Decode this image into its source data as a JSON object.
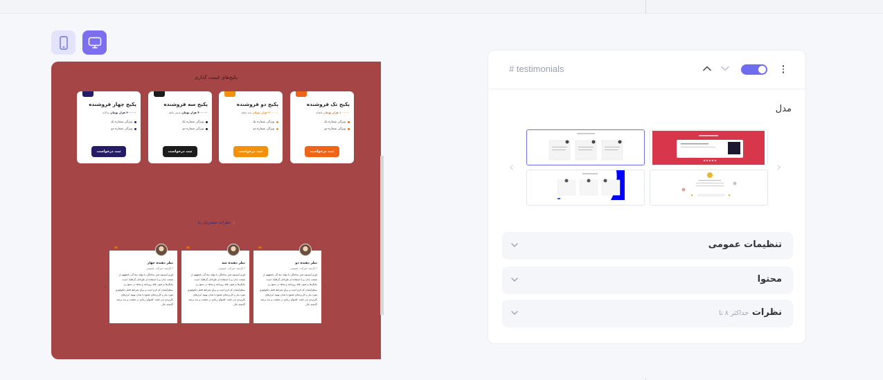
{
  "toolbar": {
    "mobile_icon": "mobile-phone-icon",
    "desktop_icon": "monitor-icon",
    "active_view": "desktop"
  },
  "preview": {
    "background": "#a64545",
    "pricing": {
      "title": "پکیج‌های قیمت گذاری",
      "plans": [
        {
          "name": "پکیج تک فروشنده",
          "price": "۱۰۰۰۰۰ هزار تومان",
          "period": "ماهانه",
          "features": [
            "ویژگی شماره یک",
            "ویژگی شماره دو"
          ],
          "button": "ثبت درخواست",
          "color": "#f0641a"
        },
        {
          "name": "پکیج دو فروشنده",
          "price": "۲۰۰۰۰۰ هزار تومان",
          "period": "سه ماهه",
          "features": [
            "ویژگی شماره یک",
            "ویژگی شماره دو"
          ],
          "button": "ثبت درخواست",
          "color": "#f3900c"
        },
        {
          "name": "پکیج سه فروشنده",
          "price": "۳۰۰۰۰۰ هزار تومان",
          "period": "شش ماهه",
          "features": [
            "ویژگی شماره یک",
            "ویژگی شماره دو"
          ],
          "button": "ثبت درخواست",
          "color": "#1c1c1c"
        },
        {
          "name": "پکیج چهار فروشنده",
          "price": "۴۰۰۰۰۰ هزار تومان",
          "period": "سالانه",
          "features": [
            "ویژگی شماره یک",
            "ویژگی شماره دو"
          ],
          "button": "ثبت درخواست",
          "color": "#241d66"
        }
      ]
    },
    "testimonials": {
      "title": "نظرات مشتریان ما",
      "items": [
        {
          "name": "نظر دهنده دو",
          "role": "/ کارمند شرکت عمومی",
          "text": "لورم ایپسوم متن ساختگی با تولید سادگی نامفهوم از صنعت چاپ و با استفاده از طراحان گرافیک است. چاپگرها و متون بلکه روزنامه و مجله در ستون و سطرآنچنان که لازم است و برای شرایط فعلی تکنولوژی مورد نیاز و کاربردهای متنوع با هدف بهبود ابزارهای کاربردی می باشد. کتابهای زیادی در شصت و سه درصد گذشته حال."
        },
        {
          "name": "نظر دهنده سه",
          "role": "/ کارمند شرکت عمومی",
          "text": "لورم ایپسوم متن ساختگی با تولید سادگی نامفهوم از صنعت چاپ و با استفاده از طراحان گرافیک است. چاپگرها و متون بلکه روزنامه و مجله در ستون و سطرآنچنان که لازم است و برای شرایط فعلی تکنولوژی مورد نیاز و کاربردهای متنوع با هدف بهبود ابزارهای کاربردی می باشد. کتابهای زیادی در شصت و سه درصد گذشته حال."
        },
        {
          "name": "نظر دهنده چهار",
          "role": "/ کارمند شرکت عمومی",
          "text": "لورم ایپسوم متن ساختگی با تولید سادگی نامفهوم از صنعت چاپ و با استفاده از طراحان گرافیک است. چاپگرها و متون بلکه روزنامه و مجله در ستون و سطرآنچنان که لازم است و برای شرایط فعلی تکنولوژی مورد نیاز و کاربردهای متنوع با هدف بهبود ابزارهای کاربردی می باشد. کتابهای زیادی در شصت و سه درصد گذشته حال."
        }
      ],
      "quote_glyph": "“",
      "prev_arrow": "‹",
      "next_arrow": "›"
    }
  },
  "panel": {
    "section_tag": "# testimonials",
    "enabled": true,
    "accent": "#6f6cf0",
    "model_label": "مدل",
    "carousel_prev": "‹",
    "carousel_next": "›",
    "accordions": [
      {
        "label": "تنظیمات عمومی",
        "note": ""
      },
      {
        "label": "محتوا",
        "note": ""
      },
      {
        "label": "نظرات",
        "note": "حداکثر ۸ تا"
      }
    ]
  }
}
